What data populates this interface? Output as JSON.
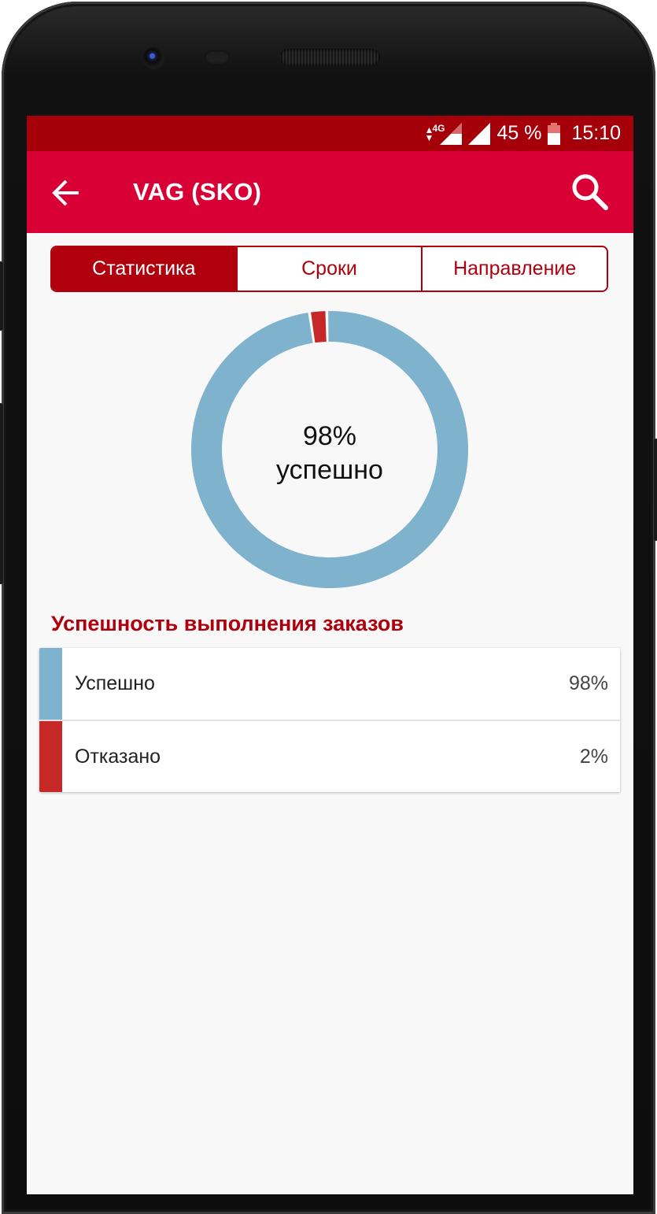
{
  "status_bar": {
    "network": "4G",
    "battery": "45 %",
    "time": "15:10"
  },
  "app_bar": {
    "title": "VAG (SKO)"
  },
  "tabs": [
    {
      "label": "Статистика",
      "active": true
    },
    {
      "label": "Сроки",
      "active": false
    },
    {
      "label": "Направление",
      "active": false
    }
  ],
  "donut": {
    "percent_text": "98%",
    "caption": "успешно"
  },
  "section_title": "Успешность выполнения заказов",
  "legend": [
    {
      "label": "Успешно",
      "value": "98%",
      "color": "#7fb2cd"
    },
    {
      "label": "Отказано",
      "value": "2%",
      "color": "#c62828"
    }
  ],
  "chart_data": {
    "type": "pie",
    "categories": [
      "Успешно",
      "Отказано"
    ],
    "values": [
      98,
      2
    ],
    "colors": [
      "#7fb2cd",
      "#c62828"
    ]
  },
  "colors": {
    "status_bar": "#a50009",
    "app_bar": "#d90036",
    "accent": "#b0000e"
  }
}
